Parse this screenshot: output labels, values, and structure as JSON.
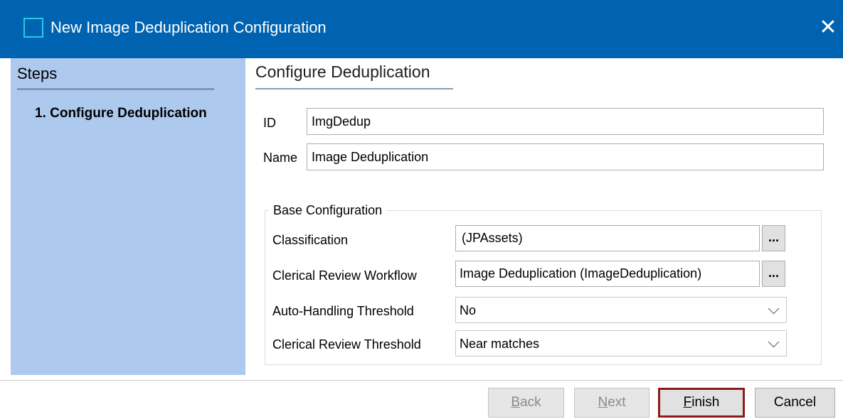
{
  "window": {
    "title": "New Image Deduplication Configuration",
    "close_glyph": "✕"
  },
  "steps": {
    "title": "Steps",
    "items": [
      {
        "label": "1. Configure Deduplication"
      }
    ]
  },
  "main": {
    "title": "Configure Deduplication",
    "id": {
      "label": "ID",
      "value": "ImgDedup"
    },
    "name": {
      "label": "Name",
      "value": "Image Deduplication"
    }
  },
  "base_config": {
    "legend": "Base Configuration",
    "classification": {
      "label": "Classification",
      "value": "(JPAssets)",
      "browse": "..."
    },
    "workflow": {
      "label": "Clerical Review Workflow",
      "value": "Image Deduplication (ImageDeduplication)",
      "browse": "..."
    },
    "auto_threshold": {
      "label": "Auto-Handling Threshold",
      "value": "No"
    },
    "review_threshold": {
      "label": "Clerical Review Threshold",
      "value": "Near matches"
    }
  },
  "buttons": {
    "back": {
      "mnemonic": "B",
      "rest": "ack",
      "enabled": false
    },
    "next": {
      "mnemonic": "N",
      "rest": "ext",
      "enabled": false
    },
    "finish": {
      "mnemonic": "F",
      "rest": "inish",
      "enabled": true
    },
    "cancel": {
      "label": "Cancel",
      "enabled": true
    }
  },
  "colors": {
    "titlebar": "#0063b1",
    "steps_panel": "#adc9ee",
    "default_button_border": "#8b1a1a"
  }
}
